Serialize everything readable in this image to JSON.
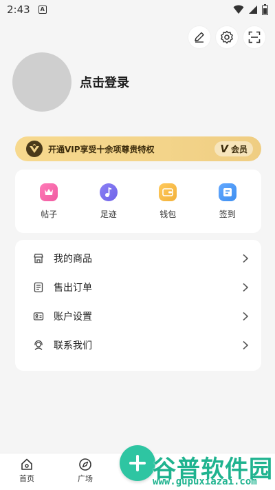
{
  "status_bar": {
    "time": "2:43",
    "badge": "A"
  },
  "profile": {
    "login_label": "点击登录"
  },
  "vip": {
    "text": "开通VIP享受十余项尊贵特权",
    "chip_mark": "V",
    "chip_label": "会员"
  },
  "quick_actions": [
    {
      "label": "帖子",
      "icon": "crown-icon",
      "color": "#f05ba0"
    },
    {
      "label": "足迹",
      "icon": "music-note-icon",
      "color": "#6f63e8"
    },
    {
      "label": "钱包",
      "icon": "wallet-icon",
      "color": "#f2b13a"
    },
    {
      "label": "签到",
      "icon": "checkin-icon",
      "color": "#3f8ff0"
    }
  ],
  "menu": [
    {
      "label": "我的商品",
      "icon": "store-icon"
    },
    {
      "label": "售出订单",
      "icon": "order-icon"
    },
    {
      "label": "账户设置",
      "icon": "account-card-icon"
    },
    {
      "label": "联系我们",
      "icon": "support-agent-icon"
    }
  ],
  "bottom_nav": {
    "home": "首页",
    "square": "广场"
  },
  "watermark": {
    "text": "谷普软件园",
    "url": "www.gupuxiazai.com"
  },
  "colors": {
    "accent": "#2ec5a2",
    "vip_gold": "#f3d48a"
  }
}
